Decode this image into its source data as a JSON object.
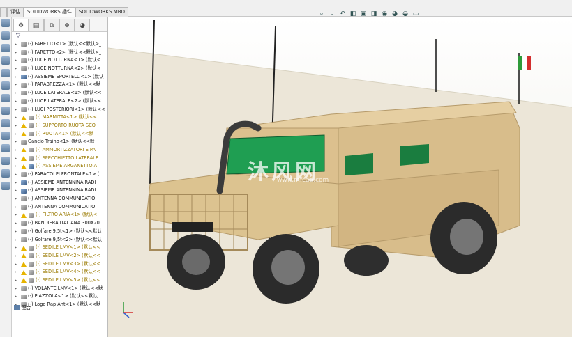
{
  "tabs": [
    {
      "label": ""
    },
    {
      "label": "评估",
      "active": false
    },
    {
      "label": "SOLIDWORKS 插件",
      "active": true
    },
    {
      "label": "SOLIDWORKS MBD",
      "active": false
    }
  ],
  "view_toolbar": [
    "zoom-fit-icon",
    "zoom-area-icon",
    "previous-view-icon",
    "section-view-icon",
    "view-orientation-icon",
    "display-style-icon",
    "hide-show-icon",
    "appearance-icon",
    "scene-icon",
    "display-monitor-icon"
  ],
  "panel_tabs": [
    "feature-manager-icon",
    "property-manager-icon",
    "configuration-manager-icon",
    "dimxpert-icon",
    "display-manager-icon"
  ],
  "tree": [
    {
      "label": "(-) FARETTO<1> (默认<<默认>_",
      "type": "part",
      "warn": false
    },
    {
      "label": "(-) FARETTO<2> (默认<<默认>_",
      "type": "part",
      "warn": false
    },
    {
      "label": "(-) LUCE NOTTURNA<1> (默认<",
      "type": "part",
      "warn": false
    },
    {
      "label": "(-) LUCE NOTTURNA<2> (默认<",
      "type": "part",
      "warn": false
    },
    {
      "label": "(-) ASSIEME SPORTELLI<1> (默认",
      "type": "asm",
      "warn": false
    },
    {
      "label": "(-) PARABREZZA<1> (默认<<默",
      "type": "part",
      "warn": false
    },
    {
      "label": "(-) LUCE LATERALE<1> (默认<<",
      "type": "part",
      "warn": false
    },
    {
      "label": "(-) LUCE LATERALE<2> (默认<<",
      "type": "part",
      "warn": false
    },
    {
      "label": "(-) LUCI POSTERIORI<1> (默认<<",
      "type": "part",
      "warn": false
    },
    {
      "label": "(-) MARMITTA<1> (默认<<",
      "type": "part",
      "warn": true
    },
    {
      "label": "(-) SUPPORTO RUOTA SCO",
      "type": "part",
      "warn": true
    },
    {
      "label": "(-) RUOTA<1> (默认<<默",
      "type": "part",
      "warn": true
    },
    {
      "label": "Gancio Traino<1> (默认<<默",
      "type": "part",
      "warn": false
    },
    {
      "label": "(-) AMMORTIZZATORI E PA",
      "type": "part",
      "warn": true
    },
    {
      "label": "(-) SPECCHIETTO LATERALE",
      "type": "part",
      "warn": true
    },
    {
      "label": "(-) ASSIEME ARGANETTO A",
      "type": "asm",
      "warn": true
    },
    {
      "label": "(-) PARACOLPI FRONTALE<1> (",
      "type": "part",
      "warn": false
    },
    {
      "label": "(-) ASSIEME ANTENNINA RADI",
      "type": "asm",
      "warn": false
    },
    {
      "label": "(-) ASSIEME ANTENNINA RADI",
      "type": "asm",
      "warn": false
    },
    {
      "label": "(-) ANTENNA COMMUNICATIO",
      "type": "part",
      "warn": false
    },
    {
      "label": "(-) ANTENNA COMMUNICATIO",
      "type": "part",
      "warn": false
    },
    {
      "label": "(-) FILTRO ARIA<1> (默认<",
      "type": "part",
      "warn": true
    },
    {
      "label": "(-) BANDIERA ITALIANA 300X20",
      "type": "part",
      "warn": false
    },
    {
      "label": "(-) Golfare 9,5t<1> (默认<<默认",
      "type": "part",
      "warn": false
    },
    {
      "label": "(-) Golfare 9,5t<2> (默认<<默认",
      "type": "part",
      "warn": false
    },
    {
      "label": "(-) SEDILE LMV<1> (默认<<",
      "type": "part",
      "warn": true
    },
    {
      "label": "(-) SEDILE LMV<2> (默认<<",
      "type": "part",
      "warn": true
    },
    {
      "label": "(-) SEDILE LMV<3> (默认<<",
      "type": "part",
      "warn": true
    },
    {
      "label": "(-) SEDILE LMV<4> (默认<<",
      "type": "part",
      "warn": true
    },
    {
      "label": "(-) SEDILE LMV<5> (默认<<",
      "type": "part",
      "warn": true
    },
    {
      "label": "(-) VOLANTE LMV<1> (默认<<默",
      "type": "part",
      "warn": false
    },
    {
      "label": "(-) PIAZZOLA<1> (默认<<默认",
      "type": "part",
      "warn": false
    },
    {
      "label": "(-) Logo Rap Ant<1> (默认<<默",
      "type": "part",
      "warn": false
    }
  ],
  "mates_label": "配合",
  "watermark": {
    "main": "沐风网",
    "sub": "www.mfcad.com"
  },
  "colors": {
    "vehicle_body": "#dcc08e",
    "window": "#1f9e52",
    "tire": "#2b2b2b",
    "flag_green": "#2e9b3a",
    "flag_red": "#d32f2f",
    "warning": "#e7b400"
  }
}
